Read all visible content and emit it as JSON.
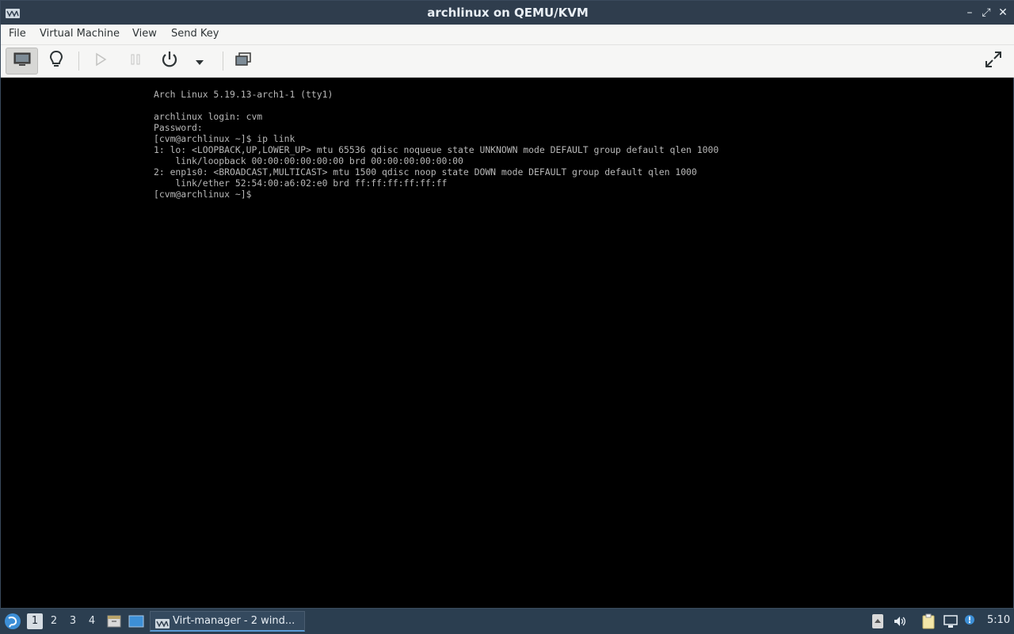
{
  "window": {
    "title": "archlinux on QEMU/KVM",
    "controls": {
      "minimize": "–",
      "restore": "⤢",
      "close": "✕"
    }
  },
  "menubar": {
    "items": [
      "File",
      "Virtual Machine",
      "View",
      "Send Key"
    ]
  },
  "toolbar": {
    "buttons": [
      {
        "name": "console-view",
        "icon": "monitor-icon",
        "active": true
      },
      {
        "name": "details-view",
        "icon": "lightbulb-icon"
      },
      {
        "name": "run",
        "icon": "play-icon"
      },
      {
        "name": "pause",
        "icon": "pause-icon"
      },
      {
        "name": "shutdown",
        "icon": "power-icon"
      },
      {
        "name": "shutdown-menu",
        "icon": "chevron-down-icon"
      },
      {
        "name": "snapshots",
        "icon": "snapshots-icon"
      },
      {
        "name": "fullscreen",
        "icon": "fullscreen-icon"
      }
    ]
  },
  "console": {
    "lines": [
      "Arch Linux 5.19.13-arch1-1 (tty1)",
      "",
      "archlinux login: cvm",
      "Password:",
      "[cvm@archlinux ~]$ ip link",
      "1: lo: <LOOPBACK,UP,LOWER_UP> mtu 65536 qdisc noqueue state UNKNOWN mode DEFAULT group default qlen 1000",
      "    link/loopback 00:00:00:00:00:00 brd 00:00:00:00:00:00",
      "2: enp1s0: <BROADCAST,MULTICAST> mtu 1500 qdisc noop state DOWN mode DEFAULT group default qlen 1000",
      "    link/ether 52:54:00:a6:02:e0 brd ff:ff:ff:ff:ff:ff",
      "[cvm@archlinux ~]$"
    ]
  },
  "taskbar": {
    "workspaces": [
      "1",
      "2",
      "3",
      "4"
    ],
    "active_workspace": "1",
    "task_label": "Virt-manager - 2 wind...",
    "clock": "5:10"
  },
  "colors": {
    "titlebar": "#2f3d4d",
    "taskbar": "#2b3e50",
    "console_text": "#b8b8b8",
    "accent": "#5b9bd5"
  }
}
